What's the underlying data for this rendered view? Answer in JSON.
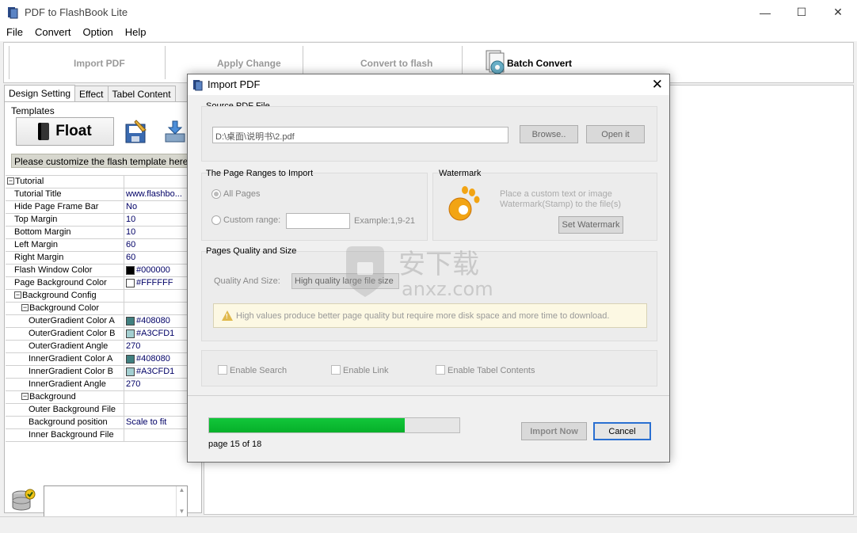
{
  "app": {
    "title": "PDF to FlashBook Lite",
    "window_controls": {
      "minimize": "—",
      "maximize": "☐",
      "close": "✕"
    }
  },
  "menu": [
    "File",
    "Convert",
    "Option",
    "Help"
  ],
  "toolbar": {
    "import_pdf": "Import PDF",
    "apply_change": "Apply Change",
    "convert_to_flash": "Convert to flash",
    "batch_convert": "Batch Convert"
  },
  "left_panel": {
    "tabs": [
      "Design Setting",
      "Effect",
      "Tabel Content"
    ],
    "templates_label": "Templates",
    "float_label": "Float",
    "customize_text": "Please customize the flash template here",
    "properties": [
      {
        "name": "Tutorial",
        "level": 0,
        "group": true,
        "value": ""
      },
      {
        "name": "Tutorial Title",
        "level": 1,
        "value": "www.flashbo..."
      },
      {
        "name": "Hide Page Frame Bar",
        "level": 1,
        "value": "No"
      },
      {
        "name": "Top Margin",
        "level": 1,
        "value": "10"
      },
      {
        "name": "Bottom Margin",
        "level": 1,
        "value": "10"
      },
      {
        "name": "Left Margin",
        "level": 1,
        "value": "60"
      },
      {
        "name": "Right Margin",
        "level": 1,
        "value": "60"
      },
      {
        "name": "Flash Window Color",
        "level": 1,
        "value": "#000000",
        "swatch": "#000000"
      },
      {
        "name": "Page Background Color",
        "level": 1,
        "value": "#FFFFFF",
        "swatch": "#FFFFFF"
      },
      {
        "name": "Background Config",
        "level": 1,
        "group": true,
        "value": ""
      },
      {
        "name": "Background Color",
        "level": 2,
        "group": true,
        "value": ""
      },
      {
        "name": "OuterGradient Color A",
        "level": 3,
        "value": "#408080",
        "swatch": "#408080"
      },
      {
        "name": "OuterGradient Color B",
        "level": 3,
        "value": "#A3CFD1",
        "swatch": "#A3CFD1"
      },
      {
        "name": "OuterGradient Angle",
        "level": 3,
        "value": "270"
      },
      {
        "name": "InnerGradient Color A",
        "level": 3,
        "value": "#408080",
        "swatch": "#408080"
      },
      {
        "name": "InnerGradient Color B",
        "level": 3,
        "value": "#A3CFD1",
        "swatch": "#A3CFD1"
      },
      {
        "name": "InnerGradient Angle",
        "level": 3,
        "value": "270"
      },
      {
        "name": "Background",
        "level": 2,
        "group": true,
        "value": ""
      },
      {
        "name": "Outer Background File",
        "level": 3,
        "value": ""
      },
      {
        "name": "Background position",
        "level": 3,
        "value": "Scale to fit"
      },
      {
        "name": "Inner Background File",
        "level": 3,
        "value": ""
      }
    ]
  },
  "dialog": {
    "title": "Import PDF",
    "close": "✕",
    "source_title": "Source PDF File",
    "source_path": "D:\\桌面\\说明书\\2.pdf",
    "browse": "Browse..",
    "open_it": "Open it",
    "ranges_title": "The Page Ranges to Import",
    "all_pages": "All Pages",
    "custom_range": "Custom range:",
    "custom_range_value": "",
    "custom_example": "Example:1,9-21",
    "watermark_title": "Watermark",
    "watermark_note_1": "Place a custom text or image",
    "watermark_note_2": "Watermark(Stamp) to the file(s)",
    "set_watermark": "Set Watermark",
    "quality_title": "Pages Quality and Size",
    "quality_label": "Quality And Size:",
    "quality_value": "High quality large file size",
    "quality_warning": "High values produce better page quality but require more disk space and more time to download.",
    "enable_search": "Enable Search",
    "enable_link": "Enable Link",
    "enable_tabel": "Enable Tabel Contents",
    "progress_fraction": 0.783,
    "progress_text": "page 15 of 18",
    "import_now": "Import Now",
    "cancel": "Cancel"
  },
  "site_watermark": {
    "cn": "安下载",
    "url": "anxz.com"
  }
}
